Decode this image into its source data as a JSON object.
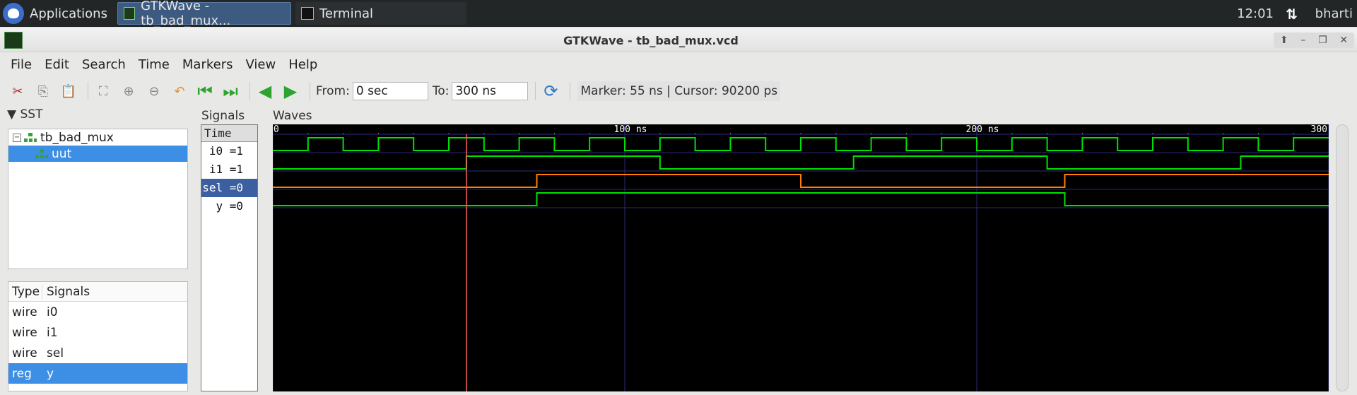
{
  "taskbar": {
    "apps_label": "Applications",
    "tasks": [
      {
        "label": "GTKWave - tb_bad_mux...",
        "active": true
      },
      {
        "label": "Terminal",
        "active": false
      }
    ],
    "clock": "12:01",
    "user": "bharti"
  },
  "window": {
    "title": "GTKWave - tb_bad_mux.vcd"
  },
  "menu": [
    "File",
    "Edit",
    "Search",
    "Time",
    "Markers",
    "View",
    "Help"
  ],
  "toolbar": {
    "from_label": "From:",
    "from_value": "0 sec",
    "to_label": "To:",
    "to_value": "300 ns",
    "marker_info": "Marker: 55 ns  |  Cursor: 90200 ps"
  },
  "sst": {
    "label": "SST",
    "tree": [
      {
        "name": "tb_bad_mux",
        "depth": 0,
        "selected": false
      },
      {
        "name": "uut",
        "depth": 1,
        "selected": true
      }
    ]
  },
  "signal_list": {
    "type_header": "Type",
    "signals_header": "Signals",
    "rows": [
      {
        "type": "wire",
        "name": "i0",
        "selected": false
      },
      {
        "type": "wire",
        "name": "i1",
        "selected": false
      },
      {
        "type": "wire",
        "name": "sel",
        "selected": false
      },
      {
        "type": "reg",
        "name": "y",
        "selected": true
      }
    ]
  },
  "signals_panel": {
    "label": "Signals",
    "time_header": "Time",
    "signals": [
      {
        "label": "i0 =1",
        "selected": false
      },
      {
        "label": "i1 =1",
        "selected": false
      },
      {
        "label": "sel =0",
        "selected": true
      },
      {
        "label": "y =0",
        "selected": false
      }
    ]
  },
  "waves": {
    "label": "Waves",
    "range_ns": [
      0,
      300
    ],
    "tick_labels": [
      {
        "value": 0,
        "text": "0"
      },
      {
        "value": 100,
        "text": "100 ns"
      },
      {
        "value": 200,
        "text": "200 ns"
      },
      {
        "value": 300,
        "text": "300"
      }
    ],
    "marker_ns": 55,
    "colors": {
      "bg": "#000000",
      "wave": "#00e000",
      "selected_wave": "#ff8000",
      "grid": "#2a2a7a",
      "marker": "#ff6060",
      "text": "#ffffff"
    },
    "traces": [
      {
        "name": "i0",
        "initial": 0,
        "transitions": [
          10,
          20,
          30,
          40,
          50,
          60,
          70,
          80,
          90,
          100,
          110,
          120,
          130,
          140,
          150,
          160,
          170,
          180,
          190,
          200,
          210,
          220,
          230,
          240,
          250,
          260,
          270,
          280,
          290
        ]
      },
      {
        "name": "i1",
        "initial": 0,
        "transitions": [
          55,
          110,
          165,
          220,
          275
        ]
      },
      {
        "name": "sel",
        "initial": 0,
        "transitions": [
          75,
          150,
          225
        ]
      },
      {
        "name": "y",
        "initial": 0,
        "transitions": [
          75,
          225
        ]
      }
    ]
  }
}
